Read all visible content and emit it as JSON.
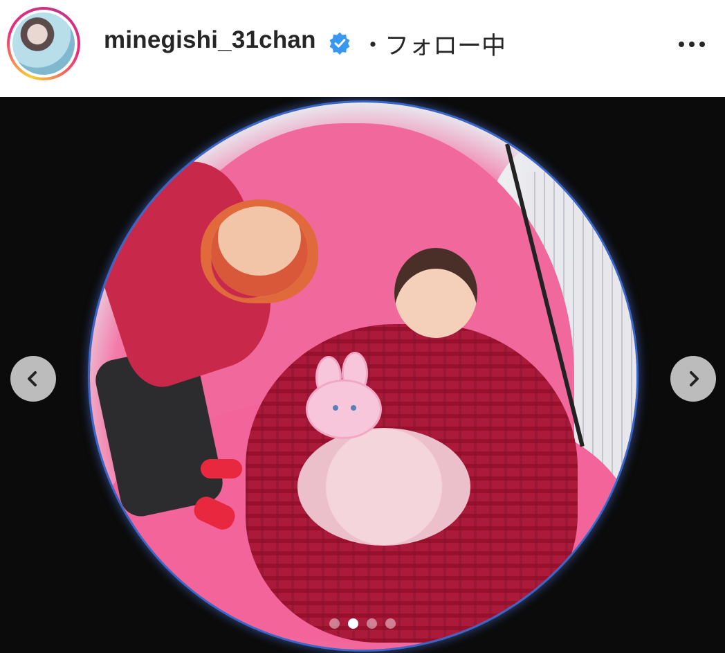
{
  "post_header": {
    "username": "minegishi_31chan",
    "verified": true,
    "separator": "・",
    "follow_status": "フォロー中",
    "more_icon": "more-horizontal-icon"
  },
  "carousel": {
    "prev_icon": "chevron-left-icon",
    "next_icon": "chevron-right-icon",
    "total_slides": 4,
    "active_slide_index": 1
  },
  "colors": {
    "verified_blue": "#3897f0",
    "text_primary": "#262626",
    "photo_background": "#0b0b0b"
  }
}
